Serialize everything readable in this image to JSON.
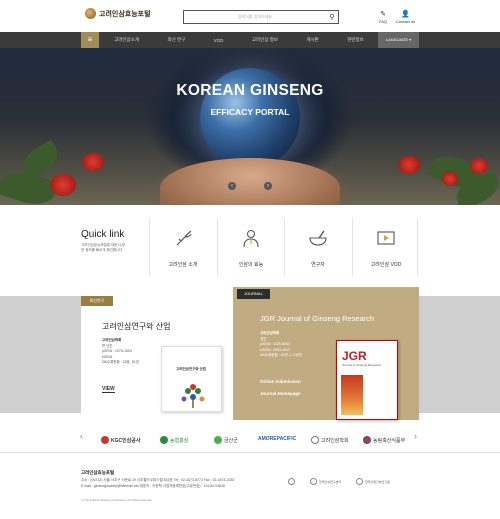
{
  "header": {
    "logo_text": "고려인삼효능포털",
    "search_placeholder": "검색어를 입력하세요",
    "faq": "FAQ",
    "contact": "Contact us"
  },
  "nav": {
    "items": [
      "고려인삼소개",
      "최신 연구",
      "VOD",
      "고려인삼 정보",
      "게시판",
      "관련정보"
    ],
    "language": "LANGUAGE ▾"
  },
  "hero": {
    "title": "KOREAN GINSENG",
    "subtitle": "EFFICACY PORTAL",
    "prev": "‹",
    "next": "›"
  },
  "quick": {
    "title": "Quick link",
    "desc": "고려인삼효능포털에 대한 다양한 정보를 빠르게 확인합니다.",
    "items": [
      "고려인삼 소개",
      "인삼의 효능",
      "연구자",
      "고려인삼 VOD"
    ]
  },
  "research": {
    "tag": "최신연구",
    "title": "고려인삼연구와 산업",
    "publisher": "고려인삼학회",
    "lines": [
      "편 년간",
      "pISSN : 1976-1503",
      "eISSN :",
      "DB수록현황 : 28호, 51권"
    ],
    "view": "VIEW",
    "book_title": "고려인삼연구와 산업"
  },
  "journal": {
    "tag": "JOURNAL",
    "title": "JGR Journal of Ginseng Research",
    "publisher": "고려인삼학회",
    "lines": [
      "계간",
      "pISSN : 1226-8453",
      "eISSN : 2093-4947",
      "DB수록현황 : 44권, 1,706편"
    ],
    "link1": "Online Submission",
    "link2": "Journal Homepage",
    "cover_title": "JGR",
    "cover_sub": "Journal of Ginseng Research"
  },
  "partners": [
    "KGC인삼공사",
    "농협홍삼",
    "금산군",
    "AMOREPACIFIC",
    "고려인삼학회",
    "농림축산식품부"
  ],
  "footer": {
    "org": "고려인삼효능포털",
    "address": "주소 : (06732) 서울 서초구 서운로 19 서초월드오피스텔 815호   Tel : 02-3473-8772   Fax : 02-3474-2330",
    "email": "E-mail : ginsengsociety@hanmail.net   대표자 : 이현학   사업자등록번호(고유번호) : 114-82-03636",
    "copyright": "© The Korean Society of Ginseng. All rights reserved.",
    "logos": [
      "고려인삼학회",
      "한국인삼연구센터",
      "한국산업기술진흥원"
    ]
  }
}
